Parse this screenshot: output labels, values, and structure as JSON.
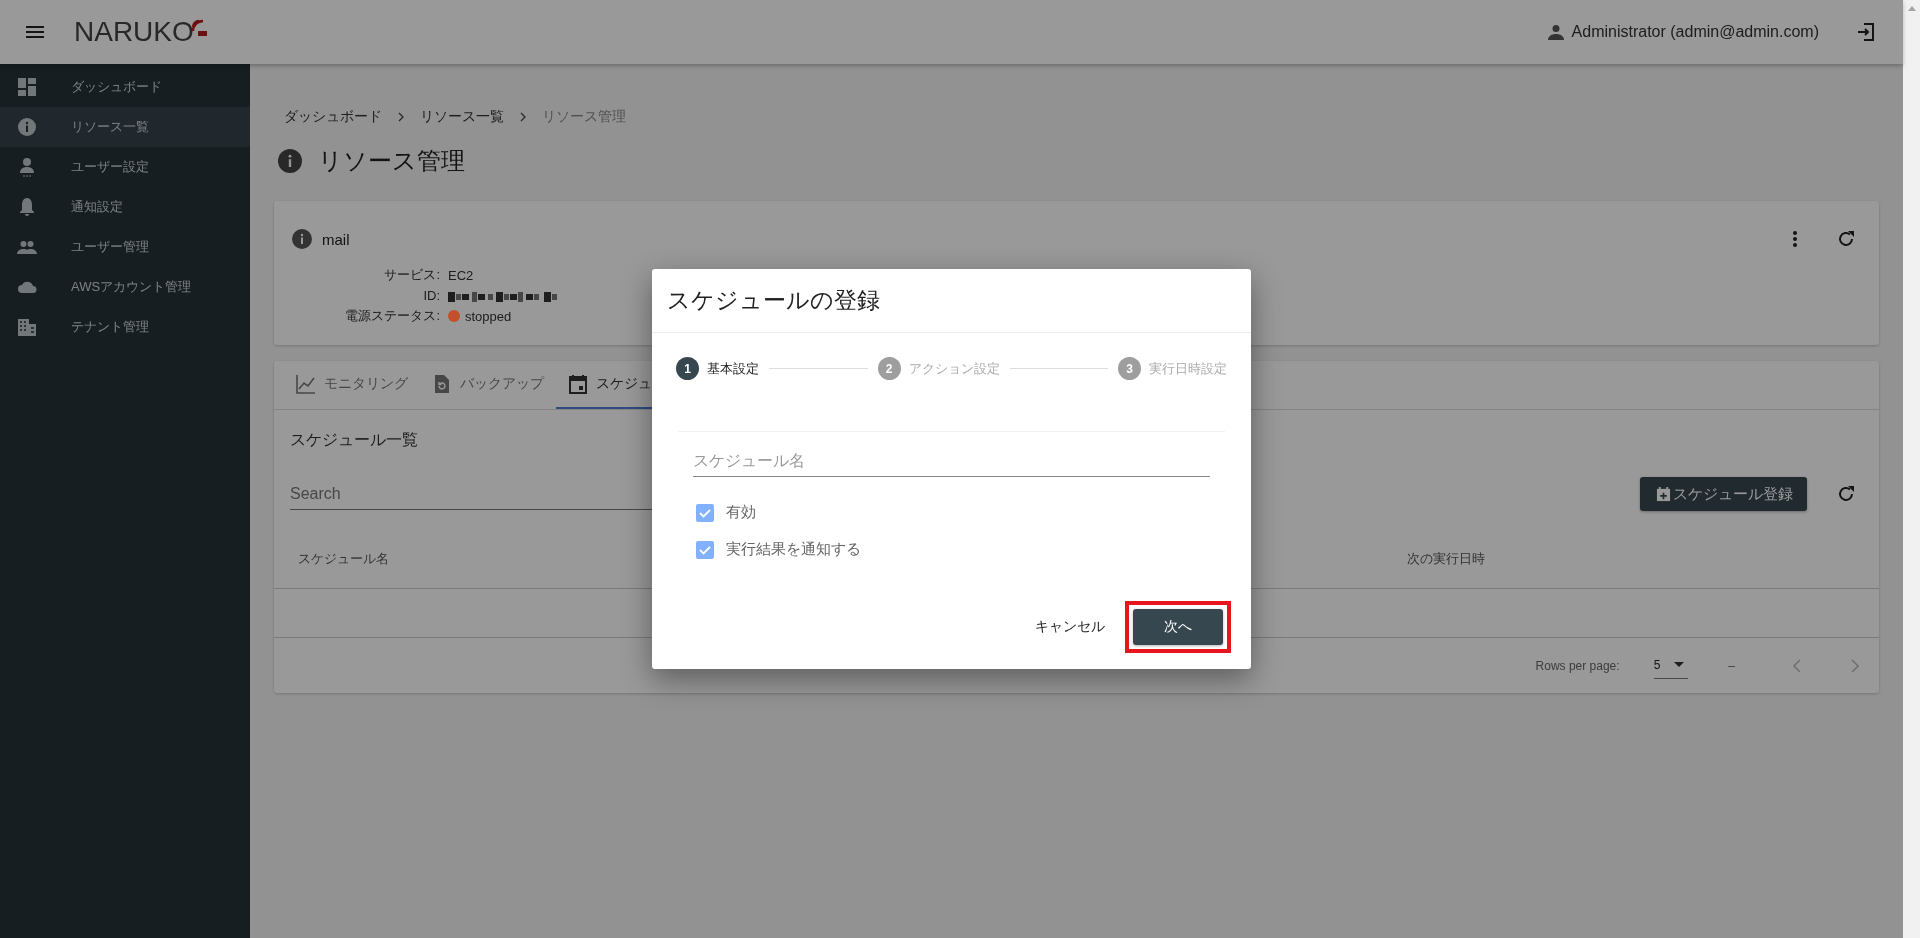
{
  "app_bar": {
    "logo": "NARUKO",
    "user": "Administrator (admin@admin.com)"
  },
  "sidebar": {
    "items": [
      {
        "label": "ダッシュボード",
        "selected": false
      },
      {
        "label": "リソース一覧",
        "selected": true
      },
      {
        "label": "ユーザー設定",
        "selected": false
      },
      {
        "label": "通知設定",
        "selected": false
      },
      {
        "label": "ユーザー管理",
        "selected": false
      },
      {
        "label": "AWSアカウント管理",
        "selected": false
      },
      {
        "label": "テナント管理",
        "selected": false
      }
    ]
  },
  "breadcrumb": [
    {
      "label": "ダッシュボード",
      "current": false
    },
    {
      "label": "リソース一覧",
      "current": false
    },
    {
      "label": "リソース管理",
      "current": true
    }
  ],
  "page_title": "リソース管理",
  "resource": {
    "name": "mail",
    "fields": [
      {
        "label": "サービス:",
        "kind": "text",
        "value": "EC2"
      },
      {
        "label": "ID:",
        "kind": "redacted"
      },
      {
        "label": "電源ステータス:",
        "kind": "status",
        "value": "stopped",
        "color": "#c4502b"
      }
    ]
  },
  "tabs": [
    {
      "label": "モニタリング",
      "selected": false
    },
    {
      "label": "バックアップ",
      "selected": false
    },
    {
      "label": "スケジュ",
      "selected": true
    }
  ],
  "schedule_list": {
    "title": "スケジュール一覧",
    "search": {
      "placeholder": "Search"
    },
    "register_button": "スケジュール登録",
    "columns": [
      "スケジュール名",
      "次の実行日時"
    ],
    "pagination": {
      "rows_per_page_label": "Rows per page:",
      "rows_per_page": "5",
      "range": "–"
    }
  },
  "dialog": {
    "title": "スケジュールの登録",
    "steps": [
      {
        "number": "1",
        "label": "基本設定",
        "selected": true
      },
      {
        "number": "2",
        "label": "アクション設定",
        "selected": false
      },
      {
        "number": "3",
        "label": "実行日時設定",
        "selected": false
      }
    ],
    "name_field": {
      "placeholder": "スケジュール名"
    },
    "checkboxes": [
      {
        "label": "有効",
        "checked": true
      },
      {
        "label": "実行結果を通知する",
        "checked": true
      }
    ],
    "cancel_button": "キャンセル",
    "next_button": "次へ",
    "next_highlighted": true
  }
}
